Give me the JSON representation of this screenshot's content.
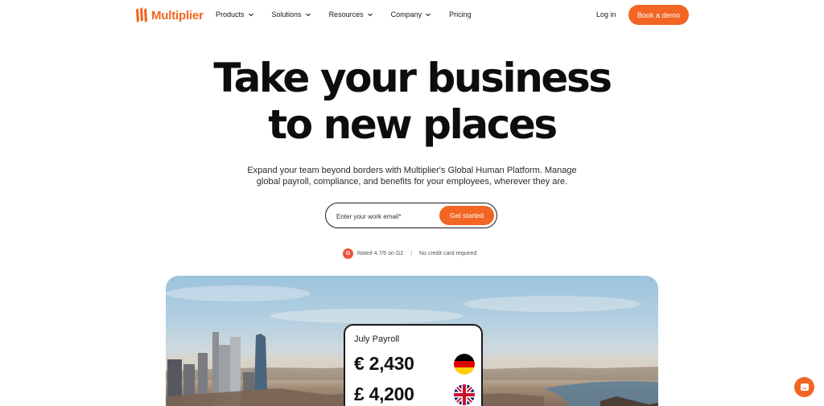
{
  "brand": {
    "name": "Multiplier",
    "color": "#f26522"
  },
  "nav": {
    "items": [
      {
        "label": "Products",
        "has_dropdown": true
      },
      {
        "label": "Solutions",
        "has_dropdown": true
      },
      {
        "label": "Resources",
        "has_dropdown": true
      },
      {
        "label": "Company",
        "has_dropdown": true
      },
      {
        "label": "Pricing",
        "has_dropdown": false
      }
    ],
    "login_label": "Log in",
    "cta_label": "Book a demo"
  },
  "hero": {
    "title_line1": "Take your business",
    "title_line2": "to new places",
    "subtitle_line1": "Expand your team beyond borders with Multiplier's Global Human Platform. Manage",
    "subtitle_line2": "global payroll, compliance, and benefits for your employees, wherever they are.",
    "email_placeholder": "Enter your work email*",
    "cta_label": "Get started",
    "rating_badge": "G",
    "rating_text": "Rated 4.7/5 on G2",
    "separator": "|",
    "no_card_text": "No credit card required"
  },
  "payroll_card": {
    "title": "July Payroll",
    "rows": [
      {
        "amount": "€ 2,430",
        "flag": "germany-flag-icon"
      },
      {
        "amount": "£ 4,200",
        "flag": "uk-flag-icon"
      }
    ]
  },
  "chat": {
    "icon": "chat-icon"
  }
}
